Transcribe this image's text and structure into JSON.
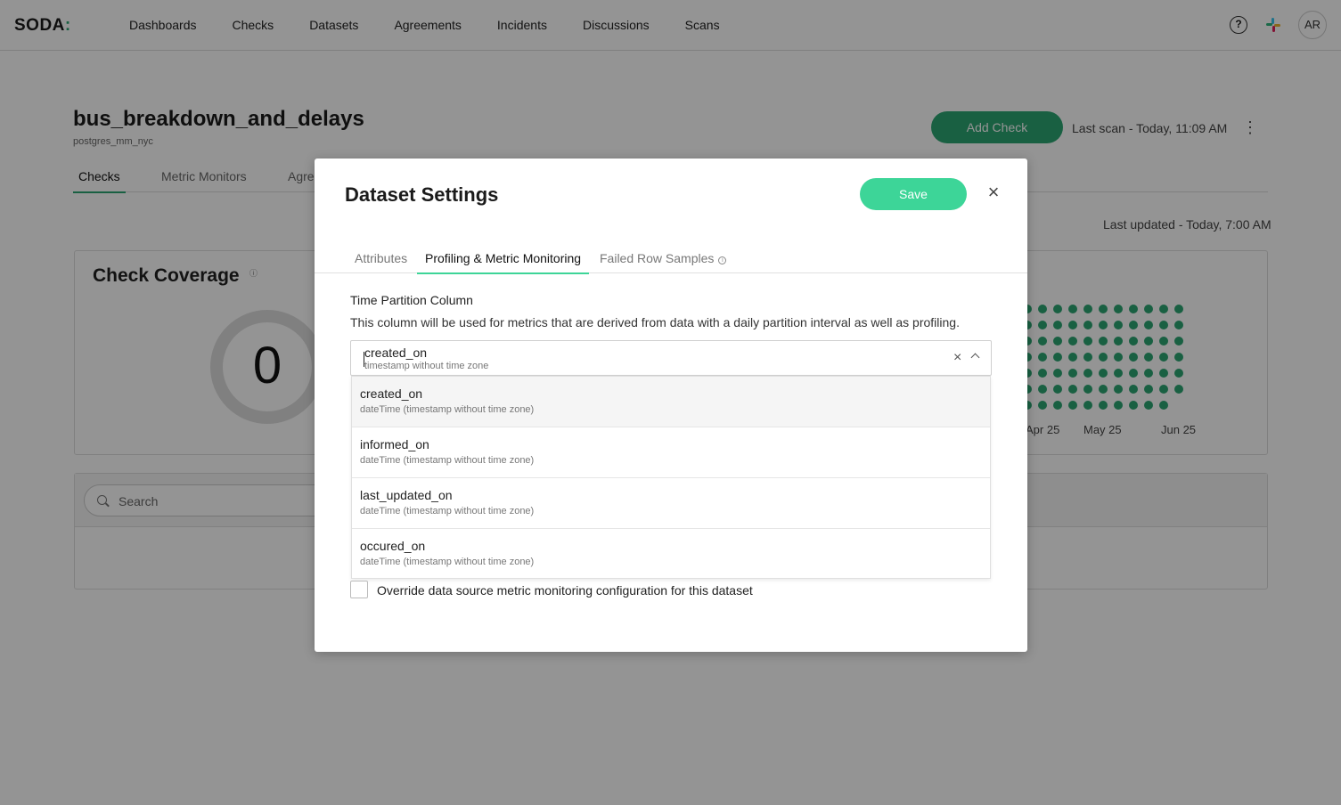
{
  "nav": {
    "logo": "SODA",
    "links": [
      "Dashboards",
      "Checks",
      "Datasets",
      "Agreements",
      "Incidents",
      "Discussions",
      "Scans"
    ],
    "help_icon": "help-circle-icon",
    "slack_icon": "slack-icon",
    "avatar_initials": "AR"
  },
  "dataset": {
    "name": "bus_breakdown_and_delays",
    "source": "postgres_mm_nyc",
    "add_check_label": "Add Check",
    "last_scan": "Last scan - Today, 11:09 AM",
    "tabs": [
      "Checks",
      "Metric Monitors",
      "Agre"
    ],
    "last_updated": "Last updated - Today, 7:00 AM"
  },
  "coverage": {
    "title": "Check Coverage",
    "value": "0",
    "months": [
      "Apr 25",
      "May 25",
      "Jun 25"
    ]
  },
  "search": {
    "placeholder": "Search"
  },
  "modal": {
    "title": "Dataset Settings",
    "save_label": "Save",
    "tabs": [
      "Attributes",
      "Profiling & Metric Monitoring",
      "Failed Row Samples"
    ],
    "active_tab": "Profiling & Metric Monitoring",
    "field_label": "Time Partition Column",
    "field_description": "This column will be used for metrics that are derived from data with a daily partition interval as well as profiling.",
    "selected": {
      "name": "created_on",
      "type": "timestamp without time zone"
    },
    "options": [
      {
        "name": "created_on",
        "type": "dateTime (timestamp without time zone)"
      },
      {
        "name": "informed_on",
        "type": "dateTime (timestamp without time zone)"
      },
      {
        "name": "last_updated_on",
        "type": "dateTime (timestamp without time zone)"
      },
      {
        "name": "occured_on",
        "type": "dateTime (timestamp without time zone)"
      }
    ],
    "override_label": "Override data source metric monitoring configuration for this dataset"
  },
  "colors": {
    "brand_green": "#2ca673",
    "save_green": "#3dd598"
  }
}
